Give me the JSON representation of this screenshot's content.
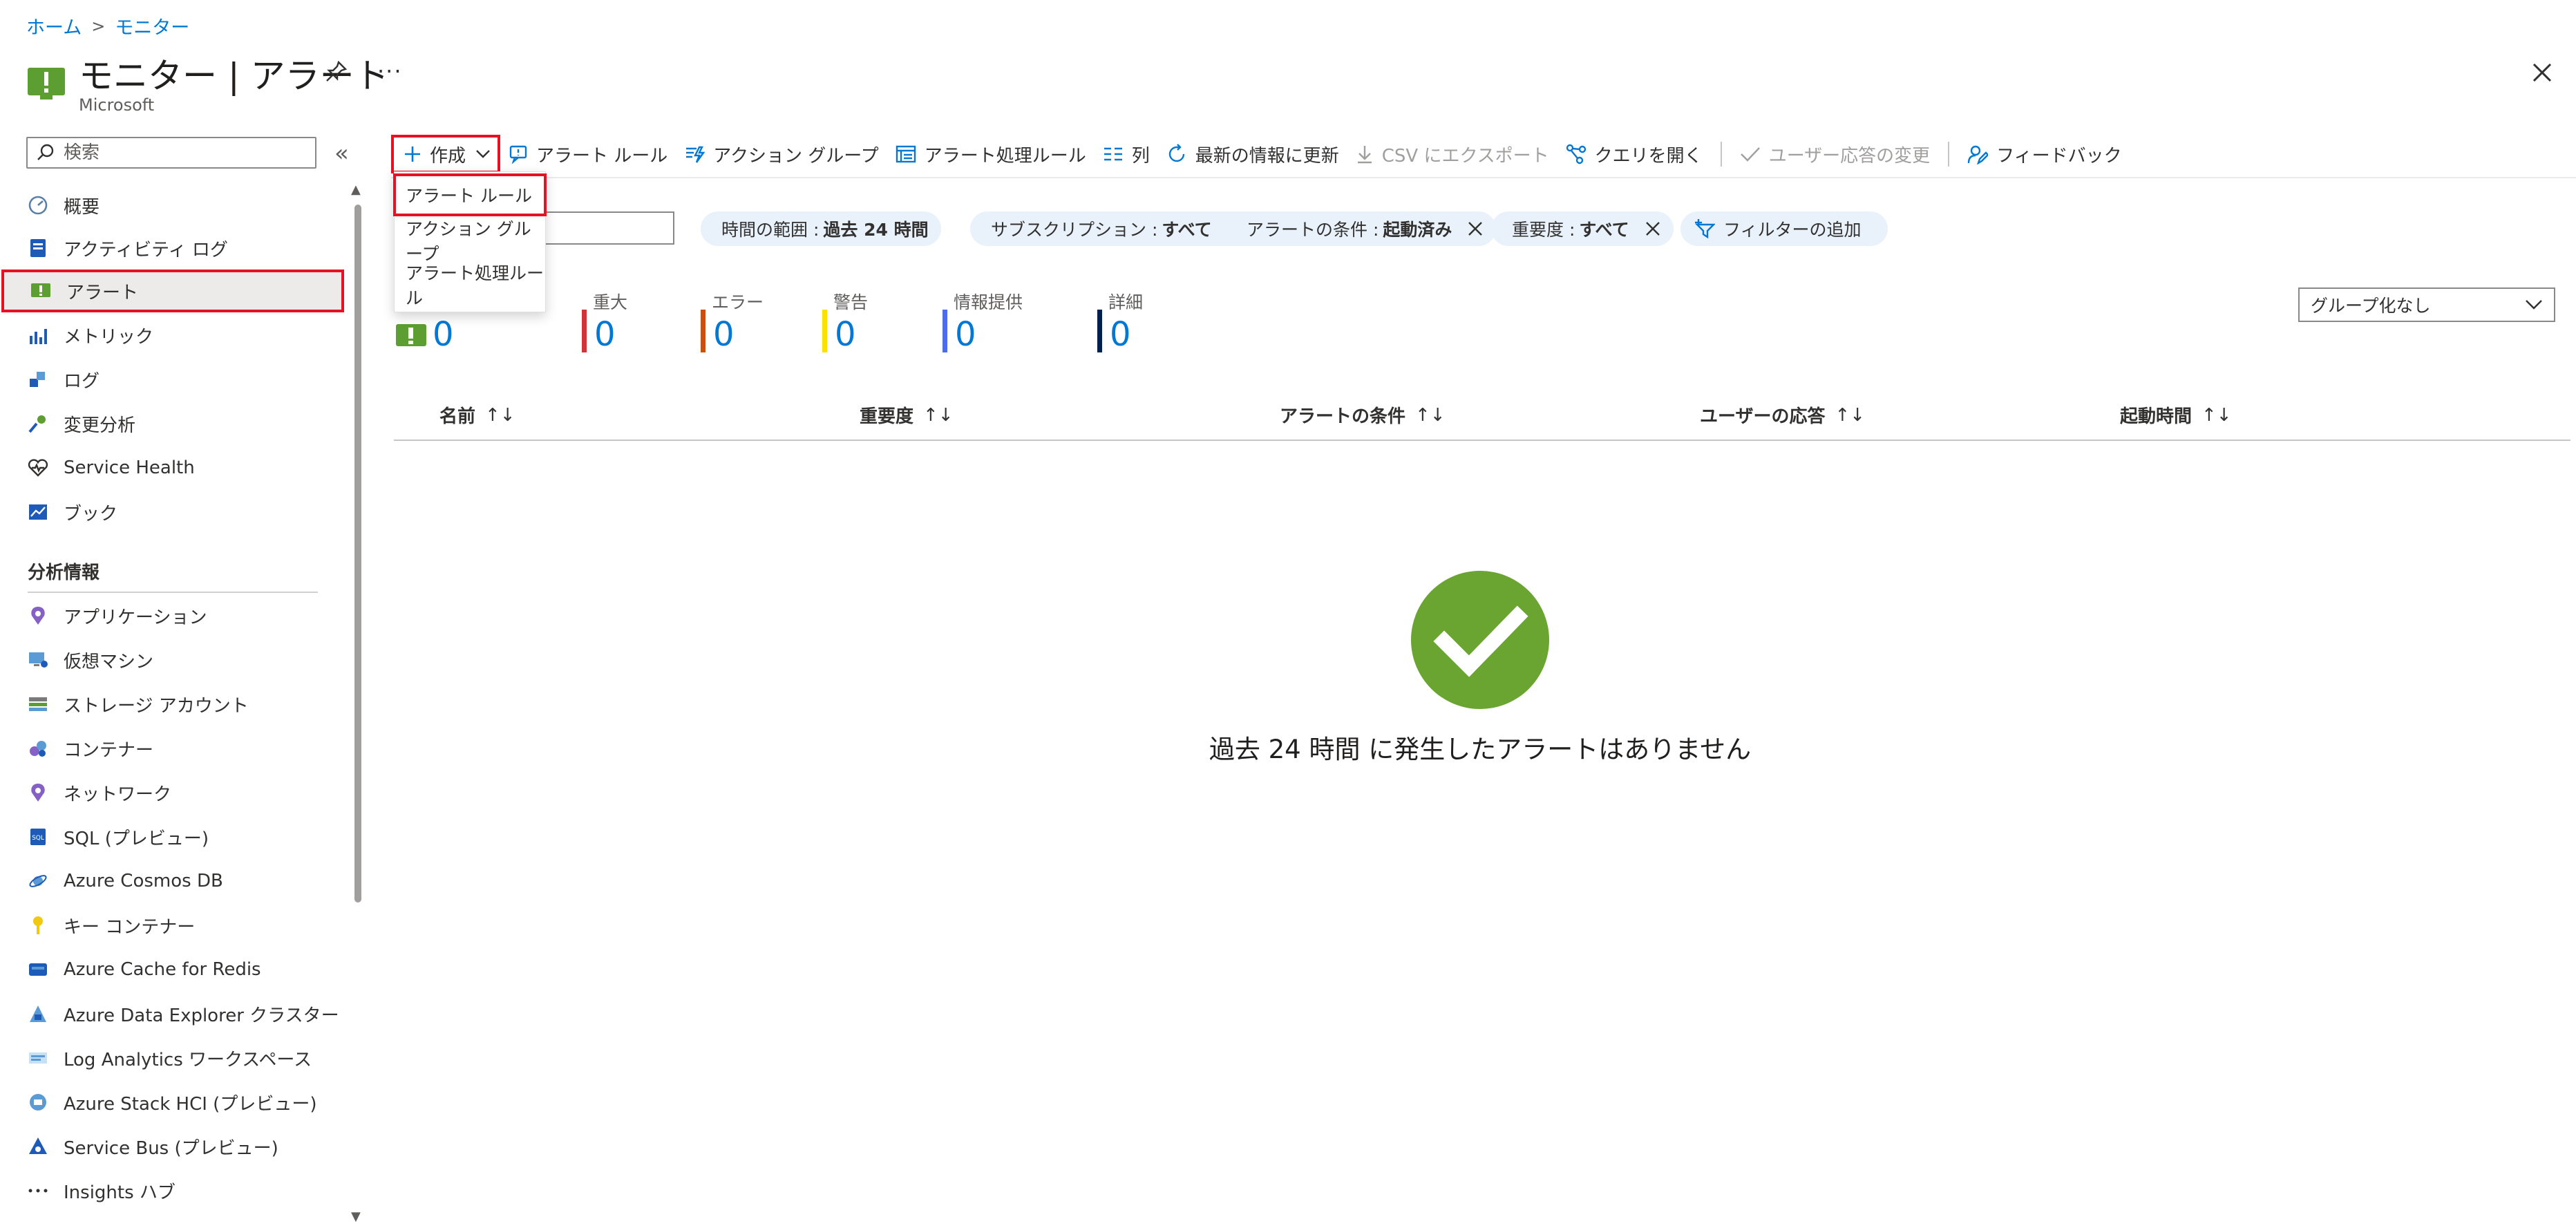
{
  "breadcrumb": {
    "home": "ホーム",
    "separator": ">",
    "current": "モニター"
  },
  "header": {
    "title": "モニター | アラート",
    "org": "Microsoft",
    "more": "···"
  },
  "sidebar": {
    "search_placeholder": "検索",
    "collapse": "«",
    "items": [
      {
        "label": "概要",
        "icon": "overview-icon"
      },
      {
        "label": "アクティビティ ログ",
        "icon": "activity-log-icon"
      },
      {
        "label": "アラート",
        "icon": "alerts-icon",
        "selected": true
      },
      {
        "label": "メトリック",
        "icon": "metrics-icon"
      },
      {
        "label": "ログ",
        "icon": "logs-icon"
      },
      {
        "label": "変更分析",
        "icon": "change-analysis-icon"
      },
      {
        "label": "Service Health",
        "icon": "heart-icon"
      },
      {
        "label": "ブック",
        "icon": "workbook-icon"
      }
    ],
    "section_title": "分析情報",
    "insights": [
      {
        "label": "アプリケーション",
        "icon": "application-icon"
      },
      {
        "label": "仮想マシン",
        "icon": "virtual-machine-icon"
      },
      {
        "label": "ストレージ アカウント",
        "icon": "storage-icon"
      },
      {
        "label": "コンテナー",
        "icon": "container-icon"
      },
      {
        "label": "ネットワーク",
        "icon": "network-icon"
      },
      {
        "label": "SQL (プレビュー)",
        "icon": "sql-icon"
      },
      {
        "label": "Azure Cosmos DB",
        "icon": "cosmos-icon"
      },
      {
        "label": "キー コンテナー",
        "icon": "key-icon"
      },
      {
        "label": "Azure Cache for Redis",
        "icon": "redis-icon"
      },
      {
        "label": "Azure Data Explorer クラスター",
        "icon": "data-explorer-icon"
      },
      {
        "label": "Log Analytics ワークスペース",
        "icon": "log-analytics-icon"
      },
      {
        "label": "Azure Stack HCI (プレビュー)",
        "icon": "stack-hci-icon"
      },
      {
        "label": "Service Bus (プレビュー)",
        "icon": "service-bus-icon"
      },
      {
        "label": "Insights ハブ",
        "icon": "ellipsis-icon"
      }
    ]
  },
  "toolbar": {
    "create": "作成",
    "alert_rules": "アラート ルール",
    "action_groups": "アクション グループ",
    "processing_rules": "アラート処理ルール",
    "columns": "列",
    "refresh": "最新の情報に更新",
    "export_csv": "CSV にエクスポート",
    "open_query": "クエリを開く",
    "change_user_response": "ユーザー応答の変更",
    "feedback": "フィードバック"
  },
  "create_menu": {
    "items": [
      "アラート ルール",
      "アクション グループ",
      "アラート処理ルール"
    ]
  },
  "filters": [
    {
      "label": "時間の範囲 :",
      "value": "過去 24 時間",
      "removable": false
    },
    {
      "label": "サブスクリプション :",
      "value": "すべて",
      "removable": true
    },
    {
      "label": "アラートの条件 :",
      "value": "起動済み",
      "removable": true
    },
    {
      "label": "重要度 :",
      "value": "すべて",
      "removable": true
    }
  ],
  "add_filter": "フィルターの追加",
  "summary": {
    "total": "0",
    "severities": [
      {
        "label": "重大",
        "value": "0",
        "color": "#d13438"
      },
      {
        "label": "エラー",
        "value": "0",
        "color": "#ca5010"
      },
      {
        "label": "警告",
        "value": "0",
        "color": "#fce100"
      },
      {
        "label": "情報提供",
        "value": "0",
        "color": "#4f6bed"
      },
      {
        "label": "詳細",
        "value": "0",
        "color": "#002050"
      }
    ]
  },
  "grouping": {
    "selected": "グループ化なし"
  },
  "table": {
    "columns": [
      "名前",
      "重要度",
      "アラートの条件",
      "ユーザーの応答",
      "起動時間"
    ],
    "sort_glyph": "↑↓"
  },
  "empty_state": {
    "message": "過去 24 時間 に発生したアラートはありません"
  },
  "colors": {
    "accent": "#0078d4",
    "highlight_border": "#e81123",
    "alert_icon_green": "#5c9e31",
    "success_green": "#6aa531"
  }
}
